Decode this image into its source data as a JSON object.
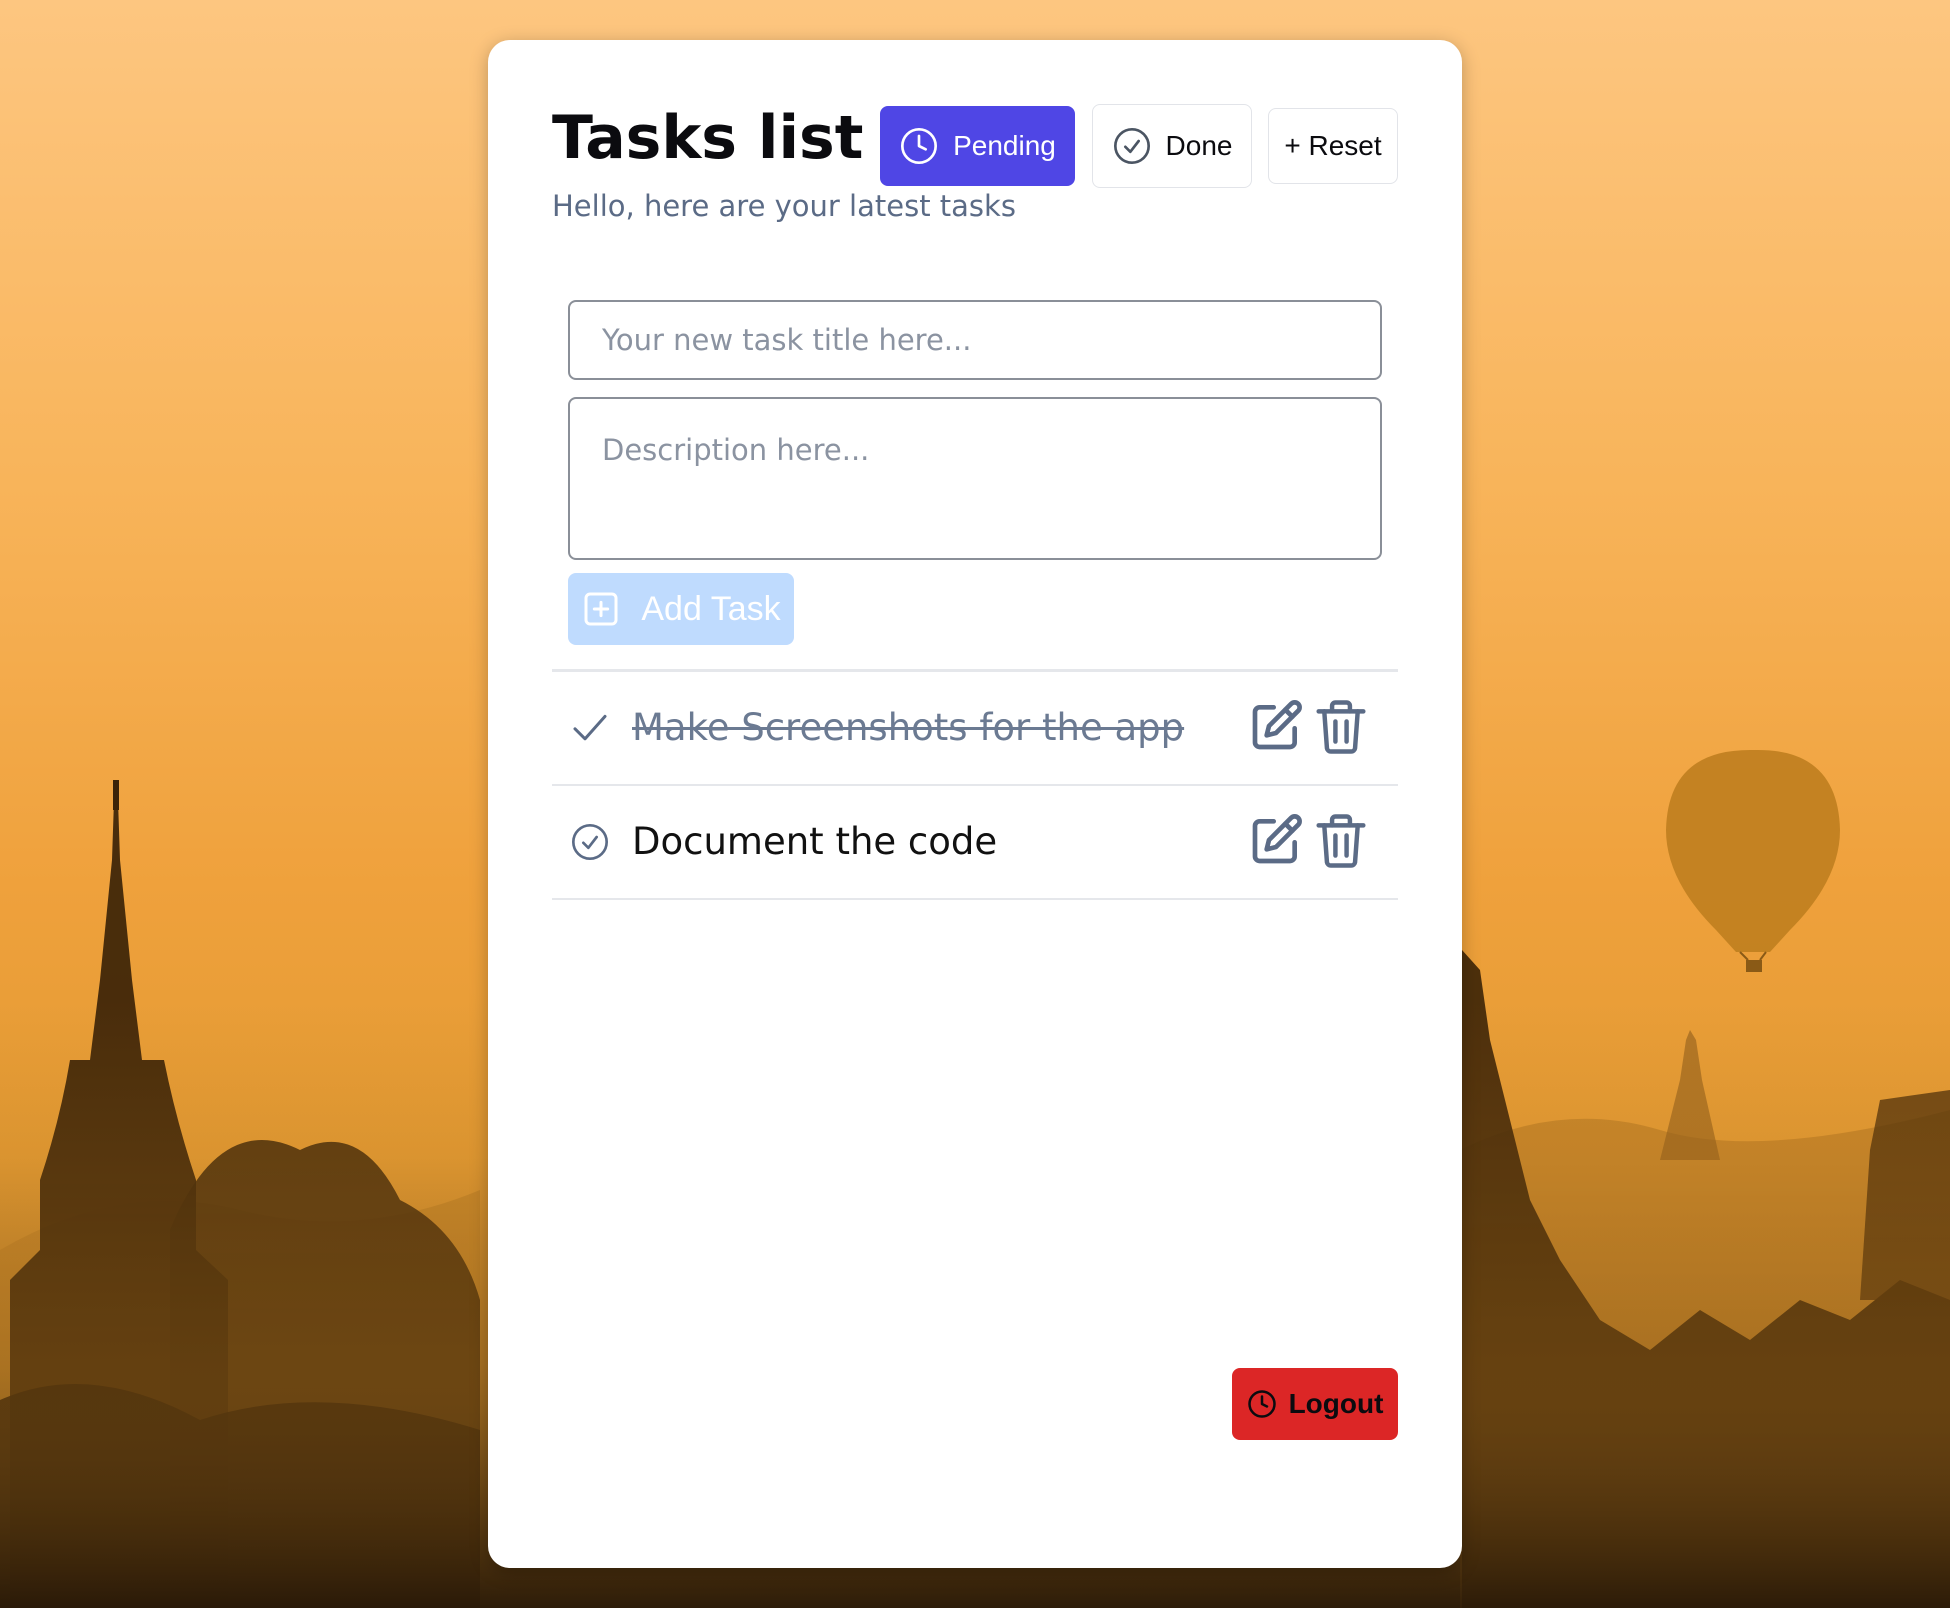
{
  "colors": {
    "accent": "#4f46e5",
    "add_button": "#bfdbfe",
    "logout": "#dc2626",
    "muted_text": "#5b6b86",
    "icon": "#5b6b86"
  },
  "header": {
    "title": "Tasks list",
    "subtitle": "Hello, here are your latest tasks"
  },
  "filters": {
    "pending_label": "Pending",
    "pending_icon": "clock-icon",
    "done_label": "Done",
    "done_icon": "check-circle-icon",
    "reset_label": "+ Reset"
  },
  "form": {
    "title_placeholder": "Your new task title here...",
    "title_value": "",
    "description_placeholder": "Description here...",
    "description_value": "",
    "add_label": "Add Task",
    "add_icon": "plus-square-icon"
  },
  "tasks": [
    {
      "title": "Make Screenshots for the app",
      "done": true,
      "status_icon": "check-icon",
      "edit_icon": "edit-icon",
      "delete_icon": "trash-icon"
    },
    {
      "title": "Document the code",
      "done": false,
      "status_icon": "check-circle-icon",
      "edit_icon": "edit-icon",
      "delete_icon": "trash-icon"
    }
  ],
  "footer": {
    "logout_label": "Logout",
    "logout_icon": "clock-icon"
  }
}
